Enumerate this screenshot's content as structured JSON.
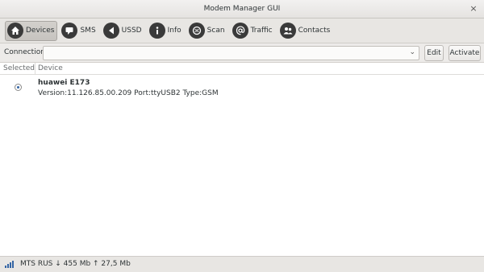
{
  "window": {
    "title": "Modem Manager GUI",
    "close_glyph": "×"
  },
  "toolbar": {
    "items": [
      {
        "label": "Devices",
        "icon": "home-icon",
        "active": true
      },
      {
        "label": "SMS",
        "icon": "sms-icon",
        "active": false
      },
      {
        "label": "USSD",
        "icon": "ussd-icon",
        "active": false
      },
      {
        "label": "Info",
        "icon": "info-icon",
        "active": false
      },
      {
        "label": "Scan",
        "icon": "scan-icon",
        "active": false
      },
      {
        "label": "Traffic",
        "icon": "traffic-icon",
        "active": false
      },
      {
        "label": "Contacts",
        "icon": "contacts-icon",
        "active": false
      }
    ]
  },
  "connection": {
    "label": "Connection",
    "selected_value": "",
    "dropdown_glyph": "⌄",
    "edit_label": "Edit",
    "activate_label": "Activate"
  },
  "device_list": {
    "columns": [
      "Selected",
      "Device"
    ],
    "rows": [
      {
        "selected": true,
        "name": "huawei E173",
        "details": "Version:11.126.85.00.209 Port:ttyUSB2 Type:GSM"
      }
    ]
  },
  "statusbar": {
    "text": "MTS RUS ↓ 455 Mb ↑ 27,5 Mb",
    "signal_bars": 4
  },
  "colors": {
    "accent": "#3465a4",
    "toolbar_bg": "#e8e6e3",
    "icon_bg": "#3a3a3a"
  }
}
